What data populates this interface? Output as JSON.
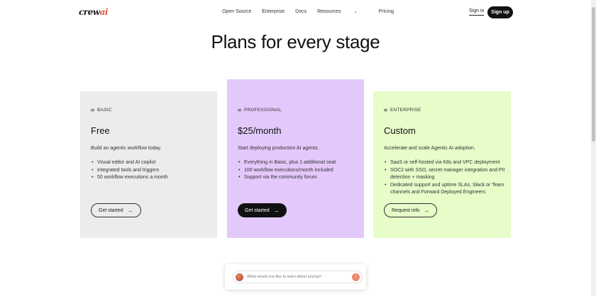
{
  "nav": {
    "logo": {
      "main": "crew",
      "accent": "ai"
    },
    "links": [
      "Open Source",
      "Enterprise",
      "Docs",
      "Resources",
      "Pricing"
    ],
    "signin": "Sign in",
    "signup": "Sign up"
  },
  "headline": "Plans for every stage",
  "plans": [
    {
      "tier": "BASIC",
      "price": "Free",
      "description": "Build an agentic workflow today.",
      "features": [
        "Visual editor and AI copilot",
        "Integrated tools and triggers",
        "50 workflow executions a month"
      ],
      "cta": "Get started",
      "color": "#ececec"
    },
    {
      "tier": "PROFESSIONAL",
      "price": "$25/month",
      "description": "Start deploying production AI agents.",
      "features": [
        "Everything in Basic, plus 1 additional seat",
        "100 workflow executions/month included",
        "Support via the community forum"
      ],
      "cta": "Get started",
      "color": "#e3c9fb"
    },
    {
      "tier": "ENTERPRISE",
      "price": "Custom",
      "description": "Accelerate and scale Agentic AI adoption.",
      "features": [
        "SaaS or self-hosted via K8s and VPC deployment",
        "SOC2 with SSO, secret manager integration and PII detection + masking",
        "Dedicated support and uptime SLAs, Slack or Team channels and Forward Deployed Engineers"
      ],
      "cta": "Request info",
      "color": "#e6fcc9"
    }
  ],
  "chat": {
    "placeholder": "What would you like to learn about pricing?"
  },
  "icons": {
    "arrow": "arrow-right-icon",
    "chevron": "chevron-down-icon",
    "tier": "tier-lines-icon"
  }
}
